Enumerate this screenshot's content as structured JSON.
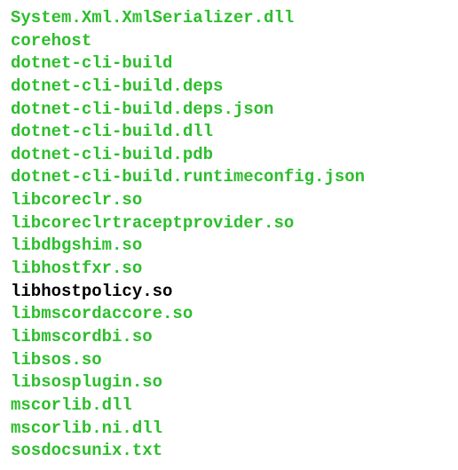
{
  "files": [
    {
      "name": "System.Xml.XmlSerializer.dll",
      "type": "exec"
    },
    {
      "name": "corehost",
      "type": "exec"
    },
    {
      "name": "dotnet-cli-build",
      "type": "exec"
    },
    {
      "name": "dotnet-cli-build.deps",
      "type": "exec"
    },
    {
      "name": "dotnet-cli-build.deps.json",
      "type": "exec"
    },
    {
      "name": "dotnet-cli-build.dll",
      "type": "exec"
    },
    {
      "name": "dotnet-cli-build.pdb",
      "type": "exec"
    },
    {
      "name": "dotnet-cli-build.runtimeconfig.json",
      "type": "exec"
    },
    {
      "name": "libcoreclr.so",
      "type": "exec"
    },
    {
      "name": "libcoreclrtraceptprovider.so",
      "type": "exec"
    },
    {
      "name": "libdbgshim.so",
      "type": "exec"
    },
    {
      "name": "libhostfxr.so",
      "type": "exec"
    },
    {
      "name": "libhostpolicy.so",
      "type": "regular"
    },
    {
      "name": "libmscordaccore.so",
      "type": "exec"
    },
    {
      "name": "libmscordbi.so",
      "type": "exec"
    },
    {
      "name": "libsos.so",
      "type": "exec"
    },
    {
      "name": "libsosplugin.so",
      "type": "exec"
    },
    {
      "name": "mscorlib.dll",
      "type": "exec"
    },
    {
      "name": "mscorlib.ni.dll",
      "type": "exec"
    },
    {
      "name": "sosdocsunix.txt",
      "type": "exec"
    }
  ]
}
